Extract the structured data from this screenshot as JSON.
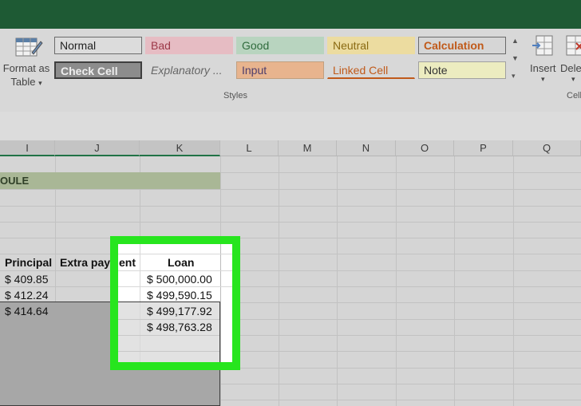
{
  "ribbon": {
    "format_as_table": {
      "line1": "Format as",
      "line2": "Table",
      "icon": "format-as-table-icon"
    },
    "styles": [
      {
        "label": "Normal",
        "bg": "#dcdcdc",
        "fg": "#222222",
        "border": "#6b6b6b"
      },
      {
        "label": "Bad",
        "bg": "#e6bcc3",
        "fg": "#9c3848",
        "border": "#e6bcc3"
      },
      {
        "label": "Good",
        "bg": "#b8d4bf",
        "fg": "#2f6b3c",
        "border": "#b8d4bf"
      },
      {
        "label": "Neutral",
        "bg": "#ecdca0",
        "fg": "#8a6a12",
        "border": "#ecdca0"
      },
      {
        "label": "Calculation",
        "bg": "#d6d6d6",
        "fg": "#c05a1a",
        "border": "#6b6b6b"
      },
      {
        "label": "Check Cell",
        "bg": "#8c8c8c",
        "fg": "#eeeeee",
        "border": "#3f3f3f"
      },
      {
        "label": "Explanatory ...",
        "bg": "#d8d8d8",
        "fg": "#666666",
        "border": "#d8d8d8"
      },
      {
        "label": "Input",
        "bg": "#e8b48e",
        "fg": "#4d3d6b",
        "border": "#c0a080"
      },
      {
        "label": "Linked Cell",
        "bg": "#d8d8d8",
        "fg": "#c05a1a",
        "border": "#d8d8d8"
      },
      {
        "label": "Note",
        "bg": "#ececc0",
        "fg": "#333333",
        "border": "#a0a0a0"
      }
    ],
    "styles_group_label": "Styles",
    "insert_label": "Insert",
    "delete_label": "Dele",
    "cells_group_label": "Cell"
  },
  "columns": [
    "I",
    "J",
    "K",
    "L",
    "M",
    "N",
    "O",
    "P",
    "Q"
  ],
  "sheet": {
    "title_fragment": "OULE",
    "headers": {
      "principal": "Principal",
      "extra": "Extra payı",
      "extra_tail": "ent",
      "loan": "Loan"
    },
    "principal_values": [
      "$ 409.85",
      "$ 412.24",
      "$ 414.64"
    ],
    "loan_values": [
      "$ 500,000.00",
      "$ 499,590.15",
      "$ 499,177.92",
      "$ 498,763.28"
    ]
  },
  "colors": {
    "highlight": "#27e51e",
    "titlebar": "#1e5a34",
    "title_band": "#a9b796"
  }
}
